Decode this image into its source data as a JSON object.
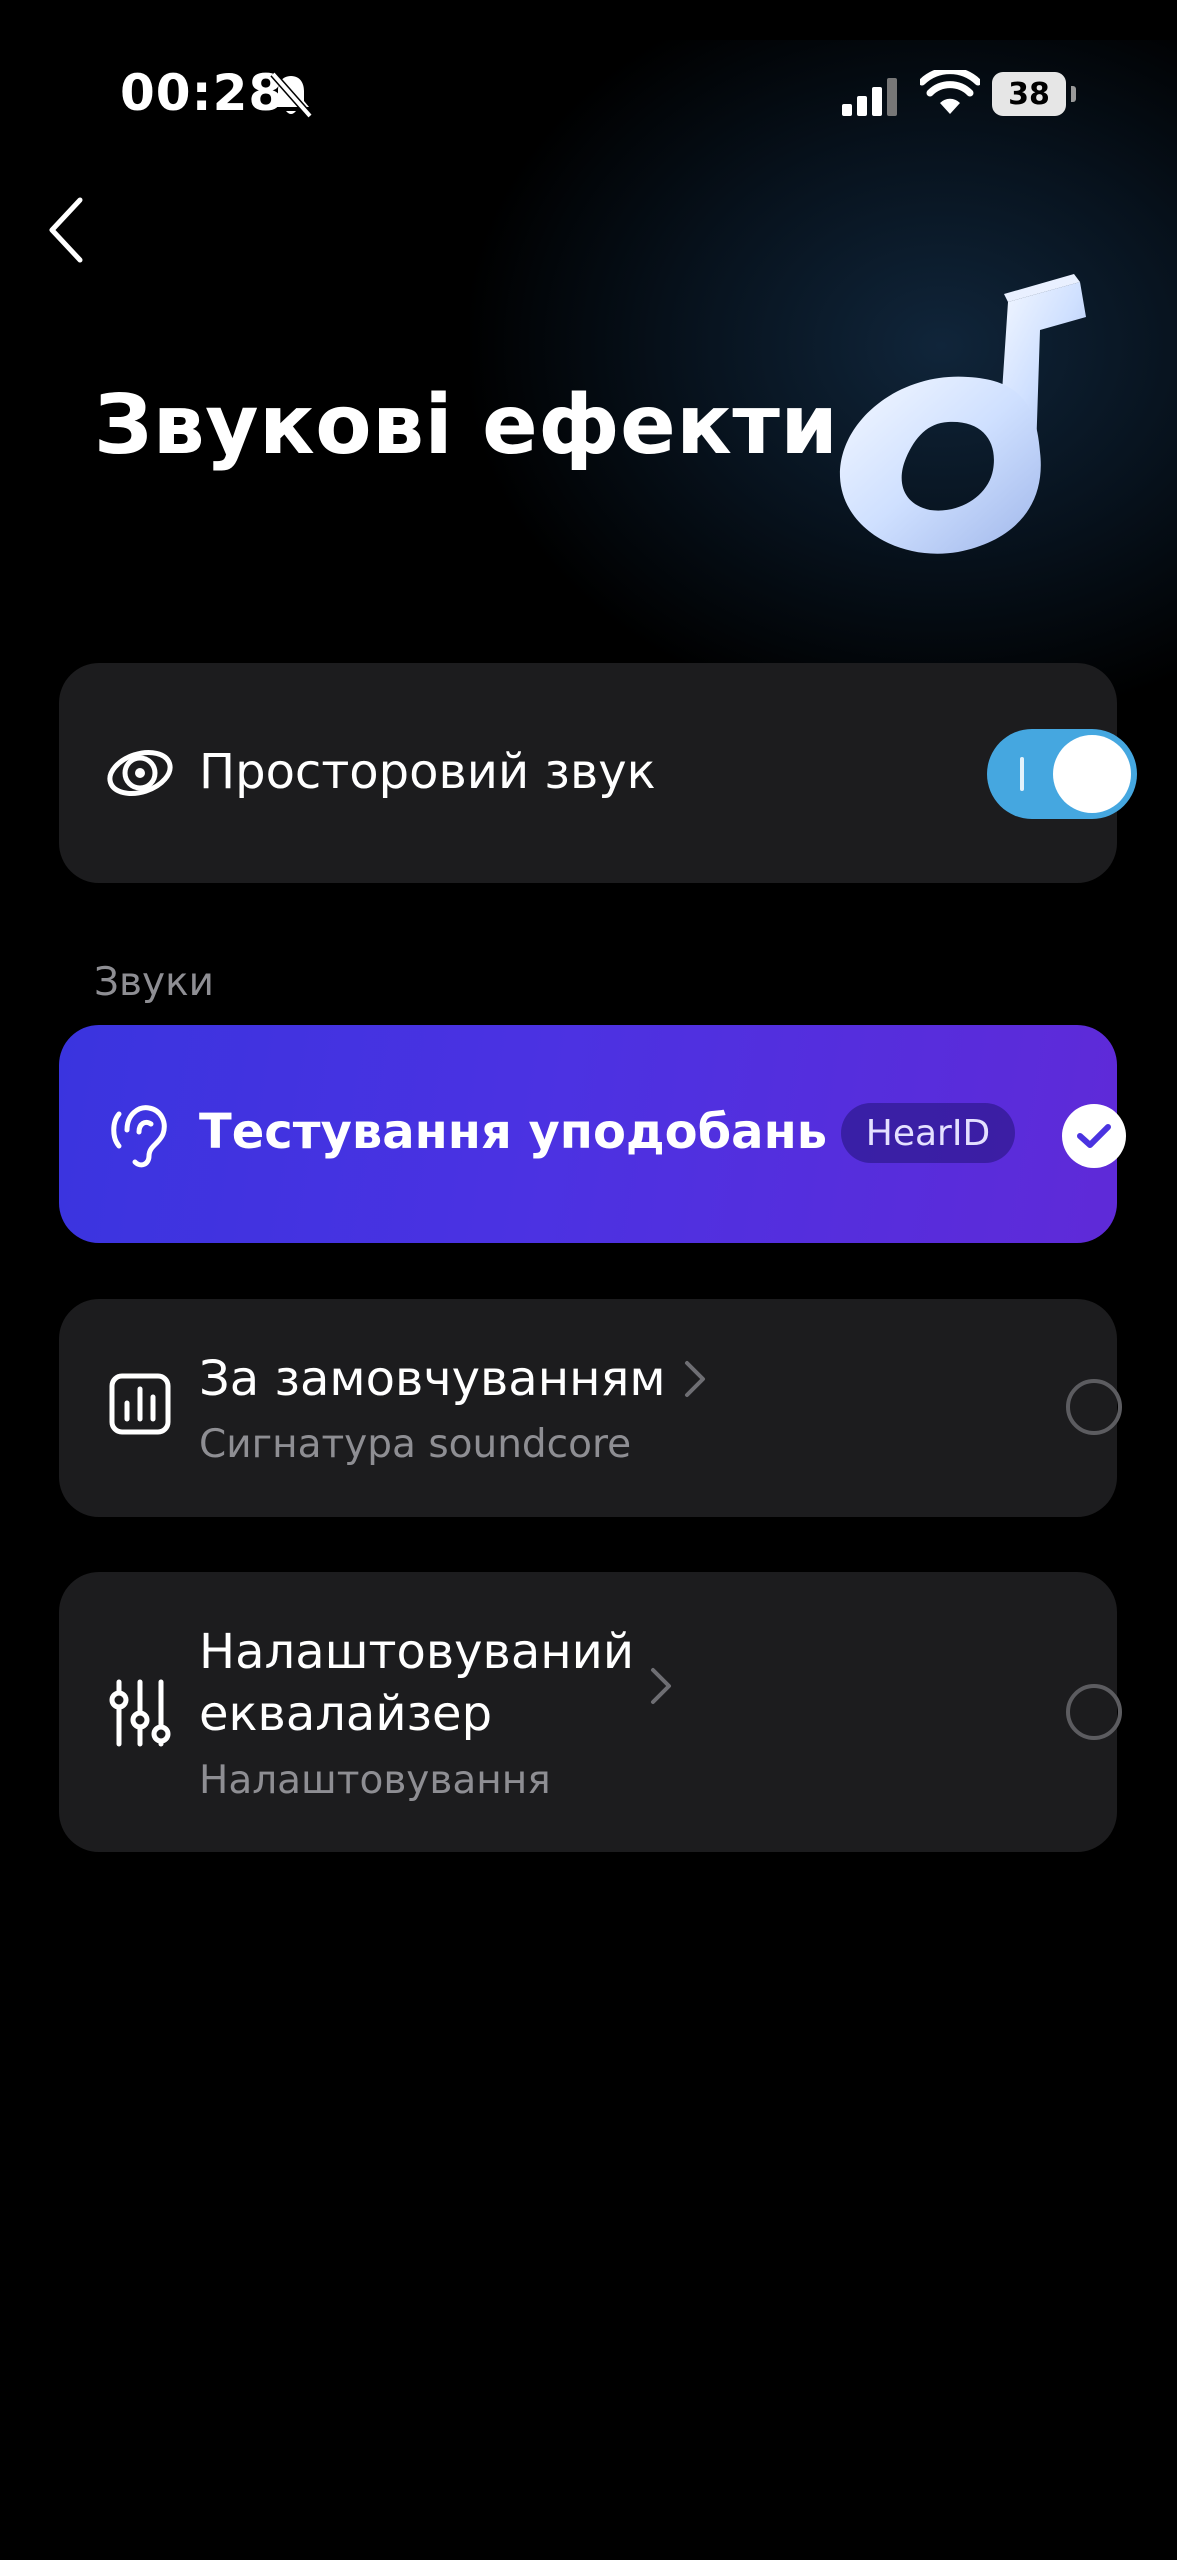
{
  "status_bar": {
    "time": "00:28",
    "battery": "38",
    "icons": [
      "bell-muted-icon",
      "cellular-signal-icon",
      "wifi-icon",
      "battery-icon"
    ]
  },
  "header": {
    "back_icon": "chevron-left-icon",
    "title": "Звукові ефекти",
    "hero_image": "soundcore-logo-3d"
  },
  "spatial_audio": {
    "icon": "spatial-audio-icon",
    "label": "Просторовий звук",
    "enabled": true
  },
  "sounds_section": {
    "label": "Звуки",
    "items": [
      {
        "icon": "ear-icon",
        "label": "Тестування уподобань",
        "badge": "HearID",
        "selected": true
      },
      {
        "icon": "equalizer-bars-icon",
        "label": "За замовчуванням",
        "sublabel": "Сигнатура soundcore",
        "selected": false
      },
      {
        "icon": "sliders-icon",
        "label_line1": "Налаштовуваний",
        "label_line2": "еквалайзер",
        "sublabel": "Налаштовування",
        "selected": false
      }
    ]
  },
  "colors": {
    "background": "#000000",
    "card": "#1c1c1e",
    "toggle_on": "#45a7e0",
    "selected_card_start": "#3a34df",
    "selected_card_end": "#5f2ad8",
    "secondary_text": "#8e8e93"
  }
}
